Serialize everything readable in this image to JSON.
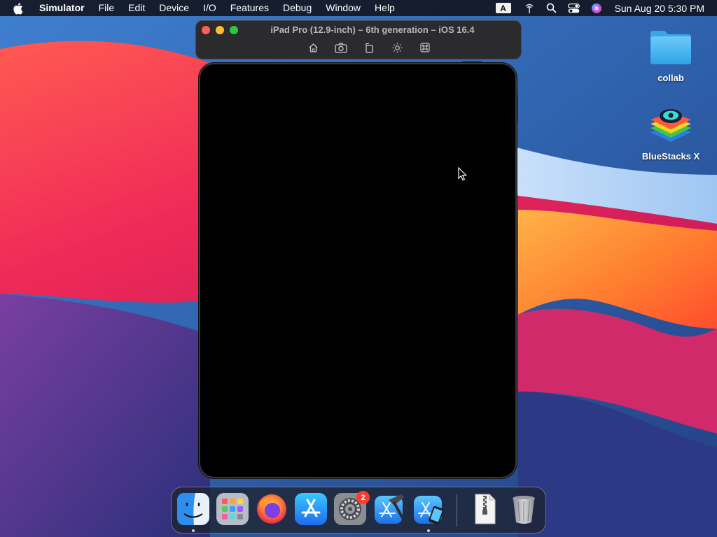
{
  "menubar": {
    "app_name": "Simulator",
    "items": [
      "File",
      "Edit",
      "Device",
      "I/O",
      "Features",
      "Debug",
      "Window",
      "Help"
    ],
    "keyboard_badge": "A",
    "clock": "Sun Aug 20  5:30 PM"
  },
  "simulator": {
    "title": "iPad Pro (12.9-inch) – 6th generation – iOS 16.4",
    "toolbar": [
      "home-icon",
      "screenshot-icon",
      "rotate-icon",
      "appearance-icon",
      "command-icon"
    ]
  },
  "desktop": {
    "icons": [
      {
        "label": "collab",
        "icon": "folder-icon"
      },
      {
        "label": "BlueStacks X",
        "icon": "bluestacks-icon"
      }
    ]
  },
  "dock": {
    "apps": [
      "finder",
      "launchpad",
      "firefox",
      "app-store",
      "system-settings",
      "xcode",
      "simulator",
      "archive-file",
      "trash"
    ],
    "system_settings_badge": "2",
    "colors": {
      "finder": "#3b8ef0",
      "firefox": "#ff7139",
      "app_store": "#1e90ff",
      "badge": "#ff3b30"
    }
  }
}
